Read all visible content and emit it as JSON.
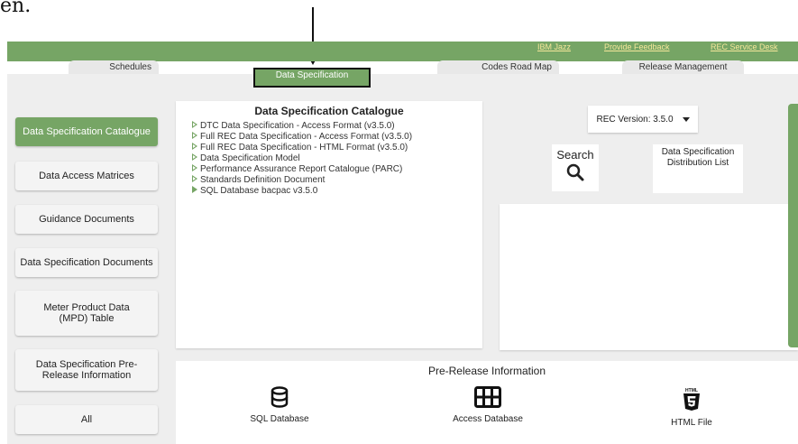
{
  "caption": "en.",
  "top_links": [
    "IBM Jazz",
    "Provide Feedback",
    "REC Service Desk"
  ],
  "tabs": [
    "Schedules",
    "Data Specification",
    "Codes Road Map",
    "Release Management"
  ],
  "sidebar": [
    "Data Specification Catalogue",
    "Data Access Matrices",
    "Guidance Documents",
    "Data Specification Documents",
    "Meter Product Data (MPD) Table",
    "Data Specification Pre-Release Information",
    "All"
  ],
  "catalogue": {
    "title": "Data Specification Catalogue",
    "items": [
      "DTC Data Specification - Access Format (v3.5.0)",
      "Full REC Data Specification - Access Format (v3.5.0)",
      "Full REC Data Specification - HTML Format (v3.5.0)",
      "Data Specification Model",
      "Performance Assurance Report Catalogue (PARC)",
      "Standards Definition Document",
      "SQL Database bacpac v3.5.0"
    ]
  },
  "version": "REC Version: 3.5.0",
  "search_label": "Search",
  "distribution_list": "Data Specification Distribution List",
  "prerelease": {
    "title": "Pre-Release Information",
    "items": [
      "SQL Database",
      "Access Database",
      "HTML File"
    ]
  },
  "html_badge": "HTML",
  "colors": {
    "accent": "#76a565",
    "link": "#f5e79a"
  },
  "icons": [
    "search-icon",
    "database-icon",
    "table-icon",
    "html5-icon"
  ]
}
